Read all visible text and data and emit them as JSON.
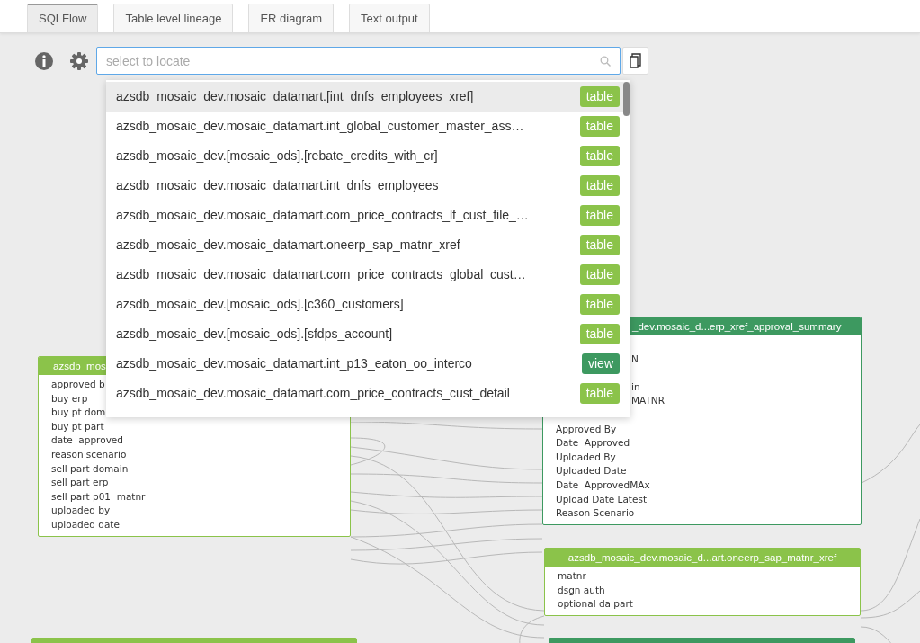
{
  "tabs": [
    {
      "label": "SQLFlow",
      "selected": true
    },
    {
      "label": "Table level lineage",
      "selected": false
    },
    {
      "label": "ER diagram",
      "selected": false
    },
    {
      "label": "Text output",
      "selected": false
    }
  ],
  "search": {
    "placeholder": "select to locate"
  },
  "dropdown": {
    "items": [
      {
        "text": "azsdb_mosaic_dev.mosaic_datamart.[int_dnfs_employees_xref]",
        "tag": "table",
        "kind": "table",
        "active": true
      },
      {
        "text": "azsdb_mosaic_dev.mosaic_datamart.int_global_customer_master_ass…",
        "tag": "table",
        "kind": "table",
        "active": false
      },
      {
        "text": "azsdb_mosaic_dev.[mosaic_ods].[rebate_credits_with_cr]",
        "tag": "table",
        "kind": "table",
        "active": false
      },
      {
        "text": "azsdb_mosaic_dev.mosaic_datamart.int_dnfs_employees",
        "tag": "table",
        "kind": "table",
        "active": false
      },
      {
        "text": "azsdb_mosaic_dev.mosaic_datamart.com_price_contracts_lf_cust_file_…",
        "tag": "table",
        "kind": "table",
        "active": false
      },
      {
        "text": "azsdb_mosaic_dev.mosaic_datamart.oneerp_sap_matnr_xref",
        "tag": "table",
        "kind": "table",
        "active": false
      },
      {
        "text": "azsdb_mosaic_dev.mosaic_datamart.com_price_contracts_global_cust…",
        "tag": "table",
        "kind": "table",
        "active": false
      },
      {
        "text": "azsdb_mosaic_dev.[mosaic_ods].[c360_customers]",
        "tag": "table",
        "kind": "table",
        "active": false
      },
      {
        "text": "azsdb_mosaic_dev.[mosaic_ods].[sfdps_account]",
        "tag": "table",
        "kind": "table",
        "active": false
      },
      {
        "text": "azsdb_mosaic_dev.mosaic_datamart.int_p13_eaton_oo_interco",
        "tag": "view",
        "kind": "view",
        "active": false
      },
      {
        "text": "azsdb_mosaic_dev.mosaic_datamart.com_price_contracts_cust_detail",
        "tag": "table",
        "kind": "table",
        "active": false
      }
    ]
  },
  "nodes": [
    {
      "kind": "table",
      "title": "azsdb_mos",
      "rows": [
        {
          "kind": "column",
          "text": "approved b"
        },
        {
          "kind": "column",
          "text": "buy erp"
        },
        {
          "kind": "column",
          "text": "buy pt dom"
        },
        {
          "kind": "column",
          "text": "buy pt part"
        },
        {
          "kind": "column",
          "text": "date  approved"
        },
        {
          "kind": "column",
          "text": "reason scenario"
        },
        {
          "kind": "column",
          "text": "sell part domain"
        },
        {
          "kind": "column",
          "text": "sell part erp"
        },
        {
          "kind": "column",
          "text": "sell part p01  matnr"
        },
        {
          "kind": "column",
          "text": "uploaded by"
        },
        {
          "kind": "column",
          "text": "uploaded date"
        }
      ]
    },
    {
      "kind": "view",
      "title": "_dev.mosaic_d...erp_xref_approval_summary",
      "rows": [
        {
          "kind": "covered"
        },
        {
          "kind": "clipped",
          "text": "N"
        },
        {
          "kind": "covered"
        },
        {
          "kind": "clipped",
          "text": "in"
        },
        {
          "kind": "clipped",
          "text": "MATNR"
        },
        {
          "kind": "covered"
        },
        {
          "kind": "column",
          "text": "Approved By"
        },
        {
          "kind": "column",
          "text": "Date  Approved"
        },
        {
          "kind": "column",
          "text": "Uploaded By"
        },
        {
          "kind": "column",
          "text": "Uploaded Date"
        },
        {
          "kind": "column",
          "text": "Date  ApprovedMAx"
        },
        {
          "kind": "column",
          "text": "Upload Date Latest"
        },
        {
          "kind": "column",
          "text": "Reason Scenario"
        }
      ]
    },
    {
      "kind": "table",
      "title": "azsdb_mosaic_dev.mosaic_d...art.oneerp_sap_matnr_xref",
      "rows": [
        {
          "kind": "column",
          "text": "matnr"
        },
        {
          "kind": "column",
          "text": "dsgn auth"
        },
        {
          "kind": "column",
          "text": "optional da part"
        }
      ]
    },
    {
      "kind": "table"
    },
    {
      "kind": "view"
    }
  ]
}
